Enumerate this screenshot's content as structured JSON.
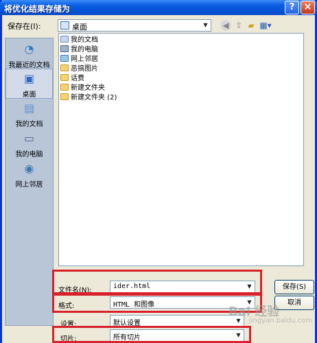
{
  "window": {
    "title": "将优化结果存储为",
    "help_glyph": "?",
    "close_glyph": "×"
  },
  "toolbar": {
    "save_in_label": "保存在(I):",
    "save_in_value": "桌面"
  },
  "places": [
    {
      "label": "我最近的文档",
      "icon": "recent-docs-icon"
    },
    {
      "label": "桌面",
      "icon": "desktop-icon"
    },
    {
      "label": "我的文档",
      "icon": "my-documents-icon"
    },
    {
      "label": "我的电脑",
      "icon": "my-computer-icon"
    },
    {
      "label": "网上邻居",
      "icon": "network-icon"
    }
  ],
  "files": [
    {
      "name": "我的文档",
      "type": "docs"
    },
    {
      "name": "我的电脑",
      "type": "pc"
    },
    {
      "name": "网上邻居",
      "type": "net"
    },
    {
      "name": "恶搞图片",
      "type": "folder"
    },
    {
      "name": "话费",
      "type": "folder"
    },
    {
      "name": "新建文件夹",
      "type": "folder"
    },
    {
      "name": "新建文件夹 (2)",
      "type": "folder"
    }
  ],
  "form": {
    "filename_label": "文件名(N):",
    "filename_value": "ider.html",
    "format_label": "格式:",
    "format_value": "HTML 和图像",
    "settings_label": "设置:",
    "settings_value": "默认设置",
    "slices_label": "切片:",
    "slices_value": "所有切片"
  },
  "buttons": {
    "save": "保存(S)",
    "cancel": "取消"
  },
  "watermark": {
    "main": "Bai 经验",
    "sub": "jingyan.baidu.com"
  },
  "colors": {
    "highlight_box": "#d8202a",
    "title_bar": "#0553d6"
  }
}
